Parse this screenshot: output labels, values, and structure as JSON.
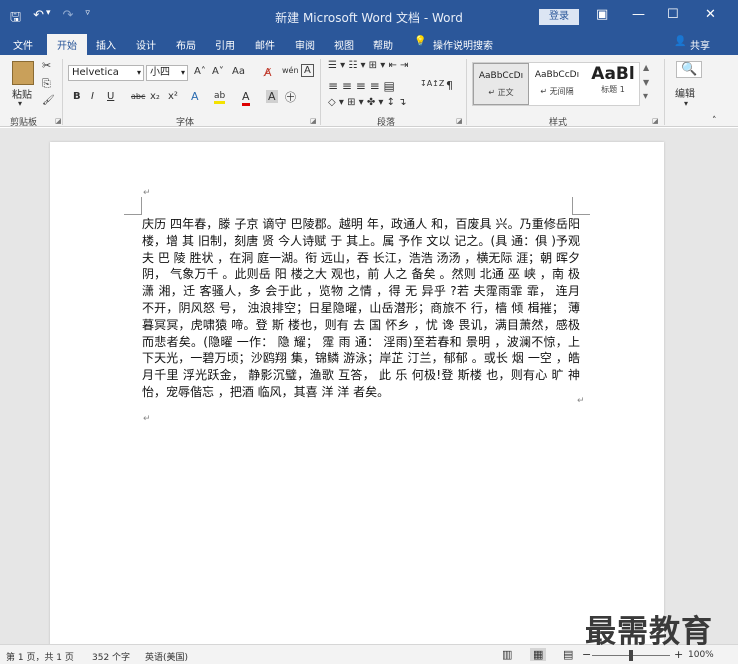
{
  "window": {
    "title": "新建 Microsoft Word 文档 - Word",
    "login_label": "登录",
    "min_glyph": "—",
    "max_glyph": "☐",
    "close_glyph": "✕",
    "ribbon_display_glyph": "▣"
  },
  "qat": {
    "save": "🖫",
    "undo": "↶",
    "undo_dd": "▾",
    "redo": "↷",
    "customize": "▿"
  },
  "tabs": [
    "文件",
    "开始",
    "插入",
    "设计",
    "布局",
    "引用",
    "邮件",
    "审阅",
    "视图",
    "帮助"
  ],
  "tell_me": {
    "icon": "💡",
    "label": "操作说明搜索"
  },
  "share": {
    "icon": "👤",
    "label": "共享"
  },
  "ribbon": {
    "clipboard": {
      "paste_label": "粘贴",
      "group_label": "剪贴板",
      "cut": "✂",
      "copy": "⎘",
      "painter": "🖌"
    },
    "font": {
      "font_name": "Helvetica",
      "font_size": "小四",
      "grow": "A˄",
      "shrink": "A˅",
      "case": "Aa",
      "clear": "A̸",
      "phonetic": "wén",
      "border_char": "A",
      "bold": "B",
      "italic": "I",
      "underline": "U",
      "strike": "abc",
      "subscript": "x₂",
      "superscript": "x²",
      "text_effect": "A",
      "highlight": "ab",
      "font_color": "A",
      "shading": "A",
      "enclose": "㊉",
      "group_label": "字体"
    },
    "paragraph": {
      "group_label": "段落",
      "row1": "☰ ▾ ☷ ▾ ⊞ ▾ ⇤ ⇥",
      "row2": "≡ ≡ ≡ ≡ ▤",
      "row3": "◇ ▾ ⊞ ▾ ✤ ▾ ↕ ↴",
      "sort": "↧A↥Z",
      "marks": "¶"
    },
    "styles": {
      "group_label": "样式",
      "items": [
        {
          "preview": "AaBbCcDı",
          "name": "↵ 正文"
        },
        {
          "preview": "AaBbCcDı",
          "name": "↵ 无间隔"
        },
        {
          "preview": "AaBl",
          "name": "标题 1"
        }
      ],
      "scroll_up": "▲",
      "scroll_down": "▼",
      "more": "▾"
    },
    "editing": {
      "label": "编辑",
      "icon": "🔍"
    }
  },
  "document": {
    "text": "庆历 四年春，滕 子京 谪守 巴陵郡。越明 年，政通人 和，百废具 兴。乃重修岳阳 楼，增 其 旧制，刻唐 贤 今人诗赋 于 其上。属 予作 文以 记之。(具 通：俱 )予观夫 巴 陵 胜状 ，在洞 庭一湖。衔 远山，吞 长江，浩浩 汤汤 ，横无际 涯；朝 晖夕阴， 气象万千 。此则岳 阳 楼之大 观也，前 人之 备矣 。然则 北通 巫 峡 ，南 极潇 湘，迁 客骚人，多 会于此 ，览物 之情 ，得 无 异乎 ?若 夫霪雨霏 霏， 连月 不开，阴风怒 号， 浊浪排空；日星隐曜，山岳潜形；商旅不 行，樯 倾 楫摧； 薄暮冥冥，虎啸猿 啼。登 斯 楼也，则有 去 国 怀乡 ，忧 谗 畏讥，满目萧然，感极而悲者矣。(隐曜 一作： 隐 耀； 霪 雨 通： 淫雨)至若春和 景明 ，波澜不惊，上下天光，一碧万顷；沙鸥翔 集，锦鳞 游泳；岸芷 汀兰，郁郁 。或长 烟 一空 ，皓月千里 浮光跃金， 静影沉璧，渔歌 互答， 此 乐 何极!登 斯楼 也，则有心 旷 神怡，宠辱偕忘 ，把酒 临风，其喜 洋 洋 者矣。",
    "para_mark": "↵"
  },
  "status": {
    "page": "第 1 页，共 1 页",
    "words": "352 个字",
    "language": "英语(美国)",
    "zoom": "100%",
    "zoom_minus": "−",
    "zoom_plus": "+",
    "view_icons": [
      "▥",
      "▦",
      "▤"
    ]
  },
  "watermark": "最需教育"
}
